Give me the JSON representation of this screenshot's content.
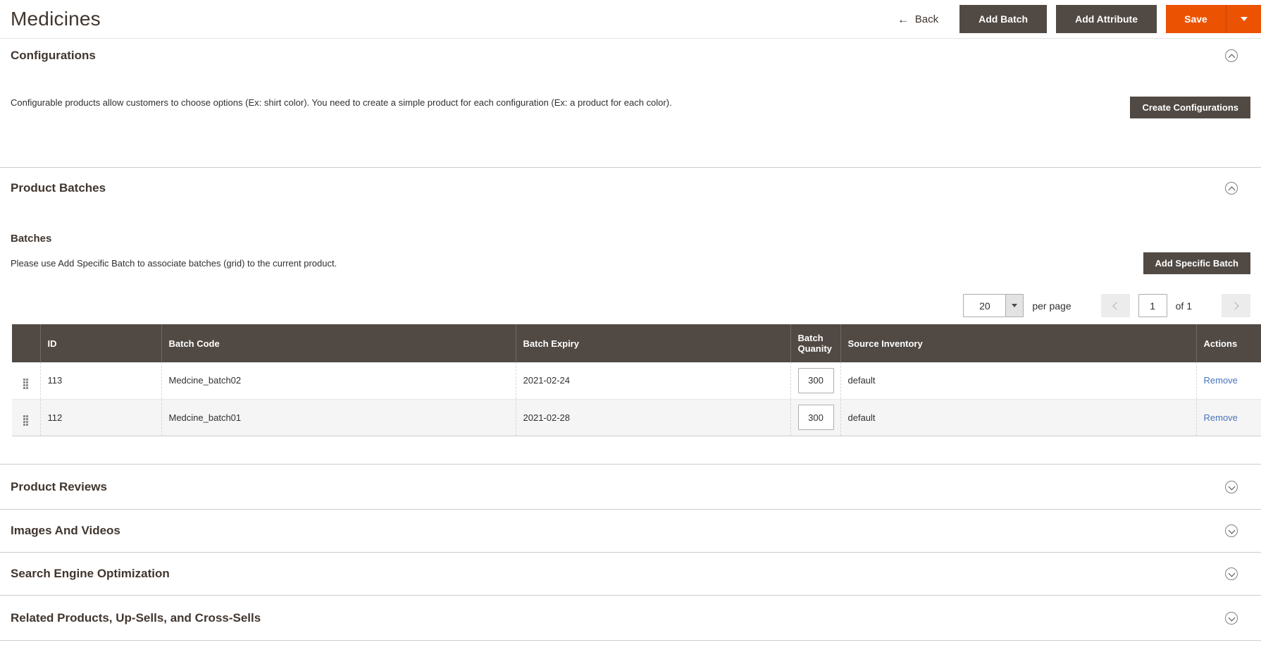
{
  "page": {
    "title": "Medicines"
  },
  "header": {
    "back_label": "Back",
    "add_batch_label": "Add Batch",
    "add_attribute_label": "Add Attribute",
    "save_label": "Save"
  },
  "icons": {
    "back_arrow": "←"
  },
  "colors": {
    "accent": "#eb5202",
    "dark_button": "#514943",
    "table_header_bg": "#514943",
    "link": "#4a73bc",
    "row_stripe": "#f5f5f5"
  },
  "configurations": {
    "title": "Configurations",
    "description": "Configurable products allow customers to choose options (Ex: shirt color). You need to create a simple product for each configuration (Ex: a product for each color).",
    "button_label": "Create Configurations"
  },
  "product_batches": {
    "title": "Product Batches",
    "subsection_title": "Batches",
    "description": "Please use Add Specific Batch to associate batches (grid) to the current product.",
    "button_label": "Add Specific Batch",
    "pager": {
      "page_size": "20",
      "per_page_label": "per page",
      "current_page": "1",
      "total_label": "of 1"
    },
    "table": {
      "columns": {
        "id": "ID",
        "batch_code": "Batch Code",
        "batch_expiry": "Batch Expiry",
        "batch_quantity": "Batch Quanity",
        "source_inventory": "Source Inventory",
        "actions": "Actions"
      },
      "rows": [
        {
          "id": "113",
          "batch_code": "Medcine_batch02",
          "batch_expiry": "2021-02-24",
          "batch_quantity": "300",
          "source_inventory": "default",
          "action_label": "Remove"
        },
        {
          "id": "112",
          "batch_code": "Medcine_batch01",
          "batch_expiry": "2021-02-28",
          "batch_quantity": "300",
          "source_inventory": "default",
          "action_label": "Remove"
        }
      ]
    }
  },
  "collapsed_sections": [
    {
      "title": "Product Reviews"
    },
    {
      "title": "Images And Videos"
    },
    {
      "title": "Search Engine Optimization"
    },
    {
      "title": "Related Products, Up-Sells, and Cross-Sells"
    }
  ]
}
